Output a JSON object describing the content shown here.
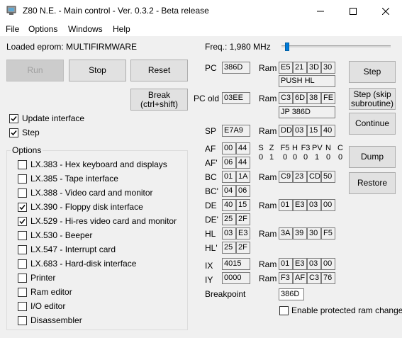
{
  "window": {
    "title": "Z80 N.E. - Main control - Ver. 0.3.2 - Beta release"
  },
  "menu": [
    "File",
    "Options",
    "Windows",
    "Help"
  ],
  "eprom": {
    "label": "Loaded eprom: MULTIFIRMWARE"
  },
  "freq": {
    "label": "Freq.: 1,980 MHz",
    "slider_fraction": 0.03
  },
  "buttons": {
    "run": "Run",
    "stop": "Stop",
    "reset": "Reset",
    "break": [
      "Break",
      "(ctrl+shift)"
    ],
    "step": "Step",
    "step_skip": [
      "Step (skip",
      "subroutine)"
    ],
    "continue": "Continue",
    "dump": "Dump",
    "restore": "Restore"
  },
  "checks": {
    "update_interface": {
      "label": "Update interface",
      "checked": true
    },
    "step": {
      "label": "Step",
      "checked": true
    }
  },
  "options": {
    "title": "Options",
    "items": [
      {
        "label": "LX.383 - Hex keyboard and displays",
        "checked": false
      },
      {
        "label": "LX.385 - Tape interface",
        "checked": false
      },
      {
        "label": "LX.388 - Video card and monitor",
        "checked": false
      },
      {
        "label": "LX.390 - Floppy disk interface",
        "checked": true
      },
      {
        "label": "LX.529 - Hi-res video card and monitor",
        "checked": true
      },
      {
        "label": "LX.530 - Beeper",
        "checked": false
      },
      {
        "label": "LX.547 - Interrupt card",
        "checked": false
      },
      {
        "label": "LX.683 - Hard-disk interface",
        "checked": false
      },
      {
        "label": "Printer",
        "checked": false
      },
      {
        "label": "Ram editor",
        "checked": false
      },
      {
        "label": "I/O editor",
        "checked": false
      },
      {
        "label": "Disassembler",
        "checked": false
      }
    ]
  },
  "registers": {
    "pc": {
      "label": "PC",
      "value": "386D",
      "ram_label": "Ram",
      "ram": [
        "E5",
        "21",
        "3D",
        "30"
      ],
      "disasm": "PUSH HL"
    },
    "pc_old": {
      "label": "PC old",
      "value": "03EE",
      "ram_label": "Ram",
      "ram": [
        "C3",
        "6D",
        "38",
        "FE"
      ],
      "disasm": "JP 386D"
    },
    "sp": {
      "label": "SP",
      "value": "E7A9",
      "ram_label": "Ram",
      "ram": [
        "DD",
        "03",
        "15",
        "40"
      ]
    },
    "af": {
      "label": "AF",
      "values": [
        "00",
        "44"
      ]
    },
    "af_alt": {
      "label": "AF'",
      "values": [
        "06",
        "44"
      ]
    },
    "bc": {
      "label": "BC",
      "values": [
        "01",
        "1A"
      ],
      "ram_label": "Ram",
      "ram": [
        "C9",
        "23",
        "CD",
        "50"
      ]
    },
    "bc_alt": {
      "label": "BC'",
      "values": [
        "04",
        "06"
      ]
    },
    "de": {
      "label": "DE",
      "values": [
        "40",
        "15"
      ],
      "ram_label": "Ram",
      "ram": [
        "01",
        "E3",
        "03",
        "00"
      ]
    },
    "de_alt": {
      "label": "DE'",
      "values": [
        "25",
        "2F"
      ]
    },
    "hl": {
      "label": "HL",
      "values": [
        "03",
        "E3"
      ],
      "ram_label": "Ram",
      "ram": [
        "3A",
        "39",
        "30",
        "F5"
      ]
    },
    "hl_alt": {
      "label": "HL'",
      "values": [
        "25",
        "2F"
      ]
    },
    "ix": {
      "label": "IX",
      "value": "4015",
      "ram_label": "Ram",
      "ram": [
        "01",
        "E3",
        "03",
        "00"
      ]
    },
    "iy": {
      "label": "IY",
      "value": "0000",
      "ram_label": "Ram",
      "ram": [
        "F3",
        "AF",
        "C3",
        "76"
      ]
    }
  },
  "flags": {
    "names": [
      "S",
      "Z",
      "F5",
      "H",
      "F3",
      "PV",
      "N",
      "C"
    ],
    "values": [
      "0",
      "1",
      "0",
      "0",
      "0",
      "1",
      "0",
      "0"
    ]
  },
  "breakpoint": {
    "label": "Breakpoint",
    "value": "386D"
  },
  "protected_ram": {
    "label": "Enable protected ram change",
    "checked": false
  }
}
